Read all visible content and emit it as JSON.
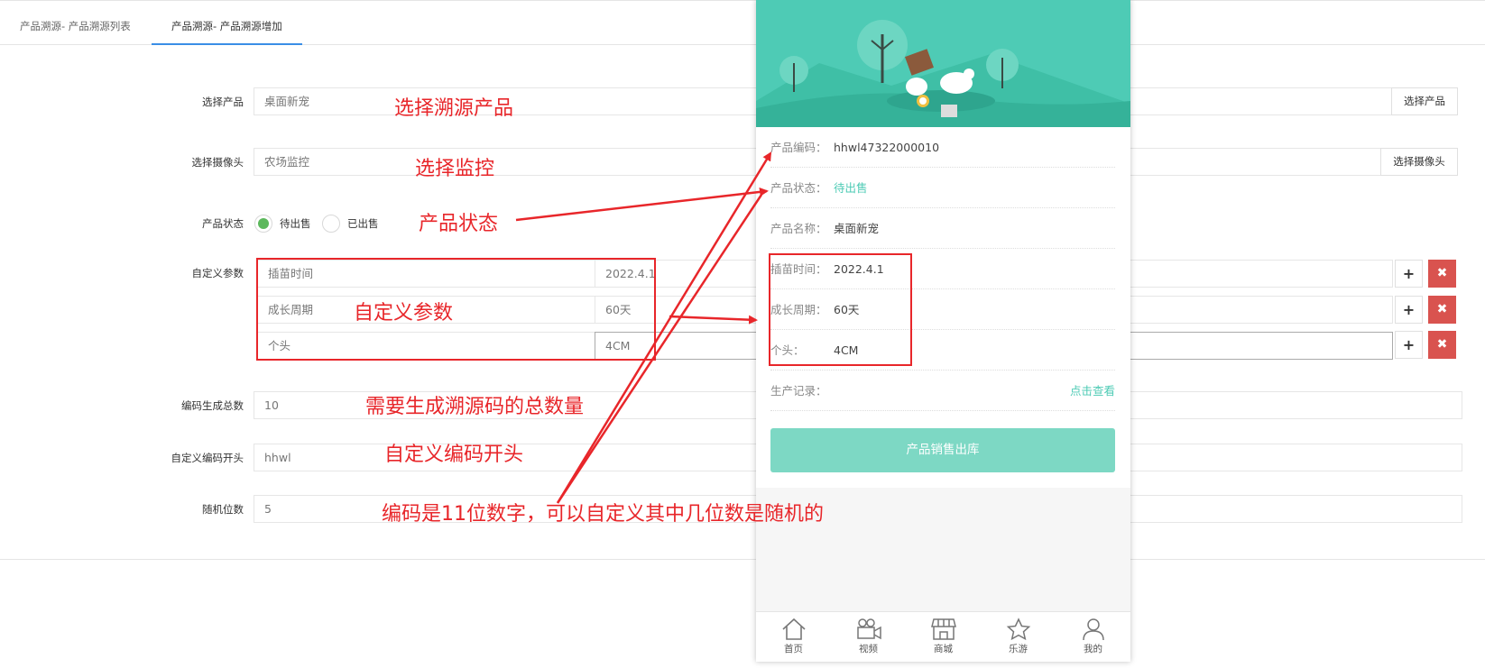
{
  "tabs": [
    {
      "label": "产品溯源- 产品溯源列表"
    },
    {
      "label": "产品溯源- 产品溯源增加"
    }
  ],
  "form": {
    "product": {
      "label": "选择产品",
      "placeholder": "桌面新宠",
      "button": "选择产品"
    },
    "camera": {
      "label": "选择摄像头",
      "placeholder": "农场监控",
      "button": "选择摄像头"
    },
    "status": {
      "label": "产品状态",
      "options": [
        "待出售",
        "已出售"
      ],
      "selected": "待出售"
    },
    "custom_params": {
      "label": "自定义参数",
      "rows": [
        {
          "name": "插苗时间",
          "value": "2022.4.1"
        },
        {
          "name": "成长周期",
          "value": "60天"
        },
        {
          "name": "个头",
          "value": "4CM"
        }
      ],
      "add_icon": "plus-icon",
      "remove_icon": "times-icon"
    },
    "total": {
      "label": "编码生成总数",
      "value": "10"
    },
    "prefix": {
      "label": "自定义编码开头",
      "value": "hhwl"
    },
    "random_digits": {
      "label": "随机位数",
      "value": "5"
    }
  },
  "annotations": {
    "product": "选择溯源产品",
    "camera": "选择监控",
    "status": "产品状态",
    "params": "自定义参数",
    "total": "需要生成溯源码的总数量",
    "prefix": "自定义编码开头",
    "code": "编码是11位数字，可以自定义其中几位数是随机的"
  },
  "phone": {
    "rows": [
      {
        "label": "产品编码：",
        "value": "hhwl47322000010"
      },
      {
        "label": "产品状态：",
        "value": "待出售"
      },
      {
        "label": "产品名称：",
        "value": "桌面新宠"
      },
      {
        "label": "插苗时间：",
        "value": "2022.4.1"
      },
      {
        "label": "成长周期：",
        "value": "60天"
      },
      {
        "label": "个头：",
        "value": "4CM"
      }
    ],
    "record": {
      "label": "生产记录：",
      "link": "点击查看"
    },
    "button": "产品销售出库",
    "nav": [
      {
        "label": "首页",
        "icon": "home-icon"
      },
      {
        "label": "视频",
        "icon": "video-camera-icon"
      },
      {
        "label": "商城",
        "icon": "store-icon"
      },
      {
        "label": "乐游",
        "icon": "star-icon"
      },
      {
        "label": "我的",
        "icon": "user-icon"
      }
    ]
  },
  "colors": {
    "accent": "#4ecbb5",
    "annotation": "#e8262a",
    "radio_checked": "#5cb85c",
    "danger": "#d9534f",
    "tab_active": "#3a8ee6"
  }
}
